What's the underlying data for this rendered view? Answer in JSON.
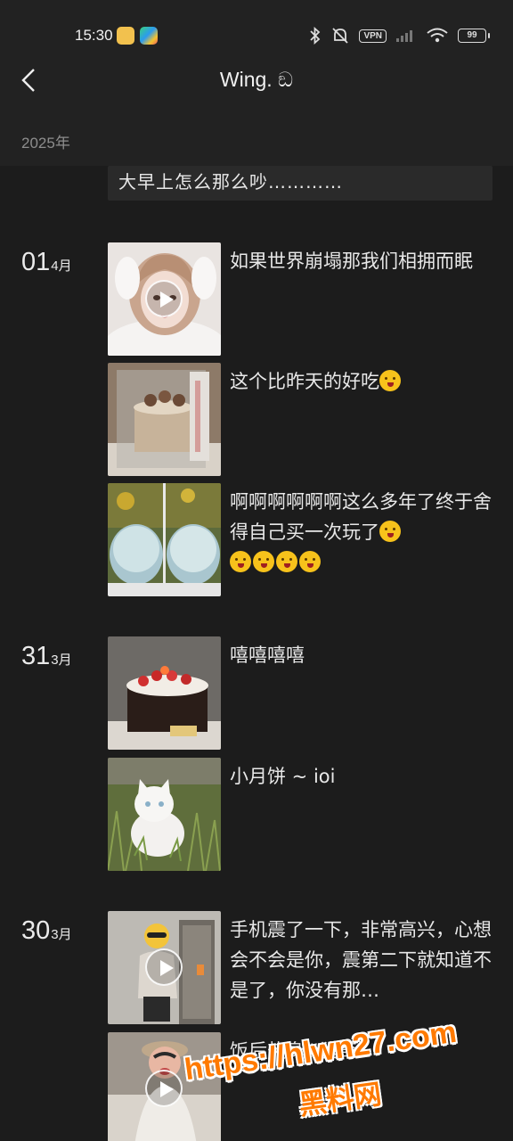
{
  "status_bar": {
    "time": "15:30",
    "vpn_label": "VPN",
    "battery": "99"
  },
  "header": {
    "title": "Wing. ඞ",
    "year": "2025年"
  },
  "previous_post": {
    "text": "大早上怎么那么吵…………"
  },
  "days": [
    {
      "day": "01",
      "month": "4月",
      "posts": [
        {
          "text": "如果世界崩塌那我们相拥而眠",
          "has_video": true,
          "thumb": "girl-portrait"
        },
        {
          "text": "这个比昨天的好吃",
          "emoji_count": 1,
          "has_video": false,
          "thumb": "boxed-cake"
        },
        {
          "text": "啊啊啊啊啊啊这么多年了终于舍得自己买一次玩了",
          "emoji_count": 5,
          "has_video": false,
          "thumb": "jelly-bowls"
        }
      ]
    },
    {
      "day": "31",
      "month": "3月",
      "posts": [
        {
          "text": "嘻嘻嘻嘻",
          "has_video": false,
          "thumb": "strawberry-cake"
        },
        {
          "text": "小月饼 ~ ioi",
          "has_video": false,
          "thumb": "white-cat"
        }
      ]
    },
    {
      "day": "30",
      "month": "3月",
      "posts": [
        {
          "text": "手机震了一下，非常高兴，心想会不会是你，震第二下就知道不是了，你没有那…",
          "has_video": true,
          "thumb": "mirror-selfie"
        },
        {
          "text": "饭后热身#猎奇",
          "has_video": true,
          "thumb": "hat-person"
        }
      ]
    }
  ],
  "watermark": {
    "url": "https://hlwn27.com",
    "name": "黑料网"
  },
  "colors": {
    "background": "#1c1c1c",
    "header_bg": "#222222",
    "text": "#e8e8e8",
    "muted": "#8d8d8d",
    "watermark": "#ff7a00"
  }
}
